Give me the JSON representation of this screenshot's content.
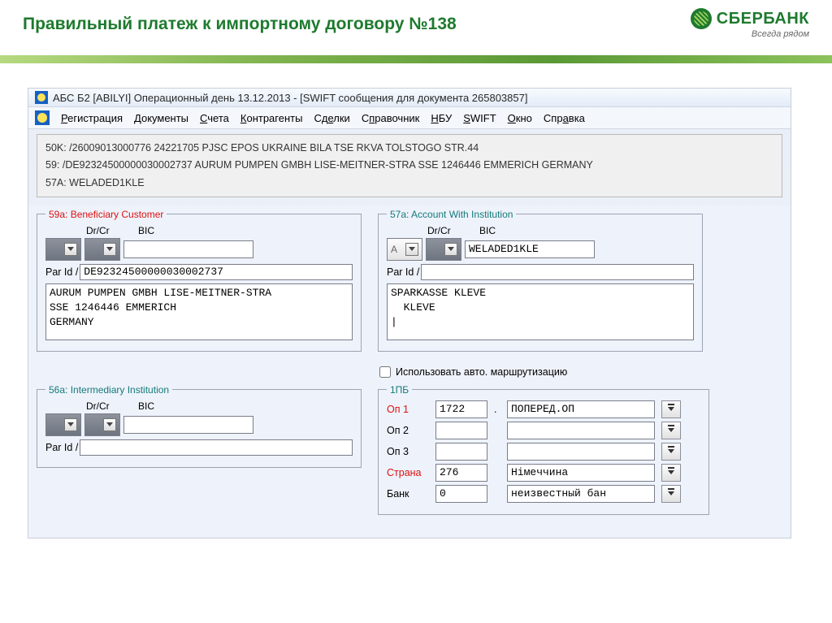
{
  "slide": {
    "title": "Правильный платеж к импортному договору №138"
  },
  "brand": {
    "name": "СБЕРБАНК",
    "tagline": "Всегда рядом"
  },
  "window": {
    "title": "АБС Б2 [ABILYI] Операционный день 13.12.2013 - [SWIFT сообщения для документа 265803857]"
  },
  "menu": {
    "registration": "Регистрация",
    "documents": "Документы",
    "accounts": "Счета",
    "counterparties": "Контрагенты",
    "deals": "Сделки",
    "reference": "Справочник",
    "nbu": "НБУ",
    "swift": "SWIFT",
    "window": "Окно",
    "help": "Справка"
  },
  "swift_block": {
    "line1": "50K: /26009013000776 24221705 PJSC EPOS UKRAINE BILA TSE RKVA TOLSTOGO STR.44",
    "line2": "59: /DE92324500000030002737 AURUM PUMPEN GMBH LISE-MEITNER-STRA SSE 1246446 EMMERICH GERMANY",
    "line3": "57A: WELADED1KLE"
  },
  "labels": {
    "drcr": "Dr/Cr",
    "bic": "BIC",
    "parid": "Par Id /",
    "auto_routing": "Использовать авто. маршрутизацию",
    "op1": "Оп 1",
    "op2": "Оп 2",
    "op3": "Оп 3",
    "country": "Страна",
    "bank": "Банк"
  },
  "legends": {
    "f59a": "59a: Beneficiary Customer",
    "f57a": "57a: Account With Institution",
    "f56a": "56a: Intermediary Institution",
    "f1pb": "1ПБ"
  },
  "f59a": {
    "bic": "",
    "parid": "DE92324500000030002737",
    "body": "AURUM PUMPEN GMBH LISE-MEITNER-STRA\nSSE 1246446 EMMERICH\nGERMANY"
  },
  "f57a": {
    "combo_val": "A",
    "bic": "WELADED1KLE",
    "parid": "",
    "body": "SPARKASSE KLEVE\n  KLEVE\n|"
  },
  "f56a": {
    "bic": "",
    "parid": ""
  },
  "pb": {
    "op1_code": "1722",
    "op1_text": "ПОПЕРЕД.ОП",
    "op2_code": "",
    "op2_text": "",
    "op3_code": "",
    "op3_text": "",
    "country_code": "276",
    "country_text": "Німеччина",
    "bank_code": "0",
    "bank_text": "неизвестный бан"
  }
}
